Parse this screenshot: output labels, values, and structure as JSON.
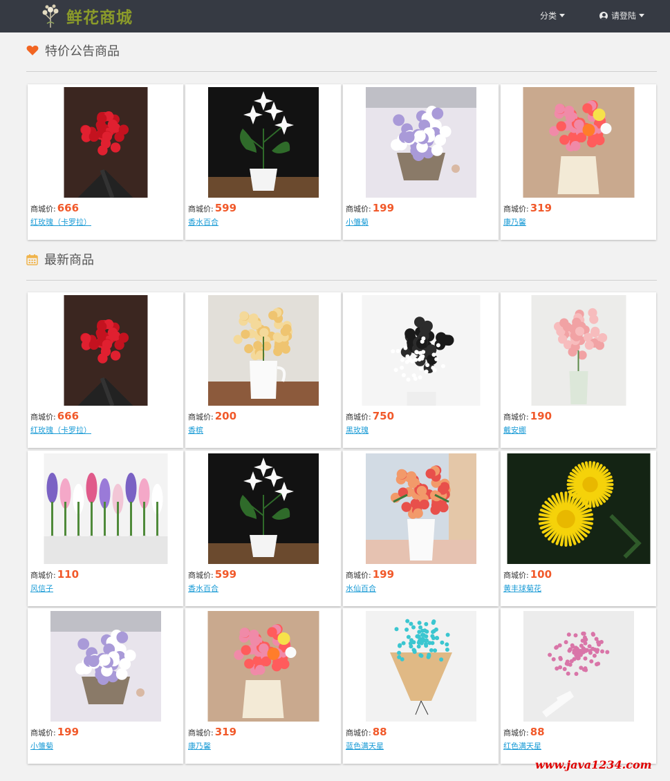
{
  "header": {
    "brand": "鲜花商城",
    "category_label": "分类",
    "login_label": "请登陆"
  },
  "sections": {
    "featured_title": "特价公告商品",
    "latest_title": "最新商品"
  },
  "price_label": "商城价:",
  "featured": [
    {
      "price": "666",
      "name": "红玫瑰（卡罗拉）"
    },
    {
      "price": "599",
      "name": "香水百合"
    },
    {
      "price": "199",
      "name": "小雏菊"
    },
    {
      "price": "319",
      "name": "康乃馨"
    }
  ],
  "latest": [
    {
      "price": "666",
      "name": "红玫瑰（卡罗拉）"
    },
    {
      "price": "200",
      "name": "香槟"
    },
    {
      "price": "750",
      "name": "黑玫瑰"
    },
    {
      "price": "190",
      "name": "戴安娜"
    },
    {
      "price": "110",
      "name": "风信子"
    },
    {
      "price": "599",
      "name": "香水百合"
    },
    {
      "price": "199",
      "name": "水仙百合"
    },
    {
      "price": "100",
      "name": "黄丰球菊花"
    },
    {
      "price": "199",
      "name": "小雏菊"
    },
    {
      "price": "319",
      "name": "康乃馨"
    },
    {
      "price": "88",
      "name": "蓝色满天星"
    },
    {
      "price": "88",
      "name": "红色满天星"
    }
  ],
  "watermark": "www.java1234.com",
  "colors": {
    "navbar": "#363a43",
    "brand": "#8b9b2a",
    "price": "#f1592a",
    "link": "#1a9bd6",
    "section_icon": "#f26522"
  }
}
